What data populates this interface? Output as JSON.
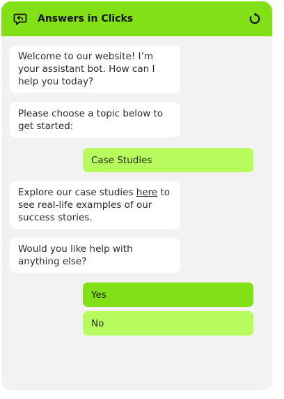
{
  "header": {
    "title": "Answers in Clicks",
    "icon_left": "chat-reply-icon",
    "icon_right": "refresh-icon",
    "accent": "#82e016"
  },
  "messages": [
    {
      "from": "bot",
      "text": "Welcome to our website! I’m your assistant bot. How can I help you today?"
    },
    {
      "from": "bot",
      "text": "Please choose a topic below to get started:"
    },
    {
      "from": "user_choice",
      "text": "Case Studies"
    },
    {
      "from": "bot",
      "text_before": "Explore our case studies ",
      "link_text": "here",
      "text_after": " to see real-life examples of our success stories."
    },
    {
      "from": "bot",
      "text": "Would you like help with anything else?"
    }
  ],
  "options": [
    {
      "label": "Yes",
      "selected": true
    },
    {
      "label": "No",
      "selected": false
    }
  ],
  "colors": {
    "panel_bg": "#f2f2f2",
    "bubble_bg": "#ffffff",
    "choice_light": "#b8fb5e",
    "choice_strong": "#82e016"
  }
}
